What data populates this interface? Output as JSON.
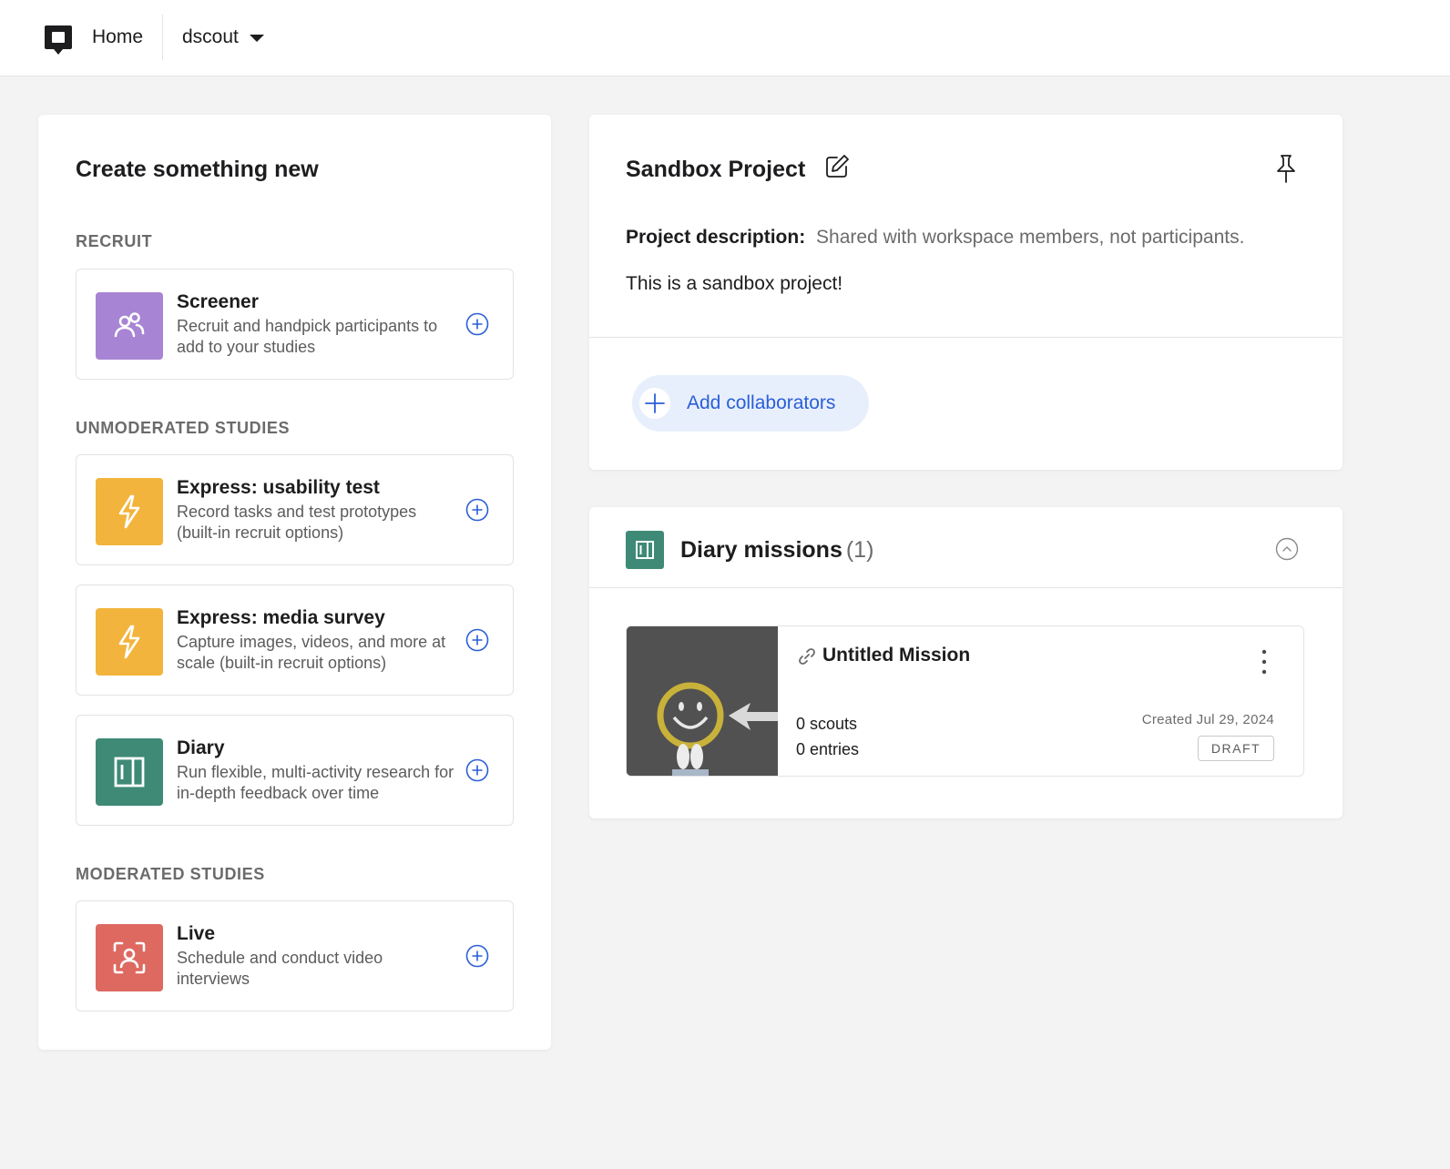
{
  "topbar": {
    "home_label": "Home",
    "workspace_label": "dscout"
  },
  "create": {
    "title": "Create something new",
    "sections": {
      "recruit": "RECRUIT",
      "unmoderated": "UNMODERATED STUDIES",
      "moderated": "MODERATED STUDIES"
    },
    "options": {
      "screener": {
        "title": "Screener",
        "desc": "Recruit and handpick participants to add to your studies",
        "icon": "people-icon",
        "color": "#a784d4"
      },
      "usability": {
        "title": "Express: usability test",
        "desc": "Record tasks and test prototypes (built-in recruit options)",
        "icon": "lightning-icon",
        "color": "#f2b43c"
      },
      "media": {
        "title": "Express: media survey",
        "desc": "Capture images, videos, and more at scale (built-in recruit options)",
        "icon": "lightning-icon",
        "color": "#f2b43c"
      },
      "diary": {
        "title": "Diary",
        "desc": "Run flexible, multi-activity research for in-depth feedback over time",
        "icon": "diary-icon",
        "color": "#3e8a76"
      },
      "live": {
        "title": "Live",
        "desc": "Schedule and conduct video interviews",
        "icon": "face-scan-icon",
        "color": "#dd6961"
      }
    }
  },
  "project": {
    "title": "Sandbox Project",
    "desc_label": "Project description:",
    "desc_text": "Shared with workspace members, not participants.",
    "body": "This is a sandbox project!",
    "collab_label": "Add collaborators"
  },
  "diary_missions": {
    "title": "Diary missions",
    "count": "(1)",
    "missions": [
      {
        "title": "Untitled Mission",
        "scouts": "0 scouts",
        "entries": "0 entries",
        "created": "Created Jul 29, 2024",
        "status": "DRAFT"
      }
    ]
  },
  "colors": {
    "accent": "#2a5ed8",
    "collab_bg": "#e8effc",
    "page_bg": "#f3f3f3"
  }
}
